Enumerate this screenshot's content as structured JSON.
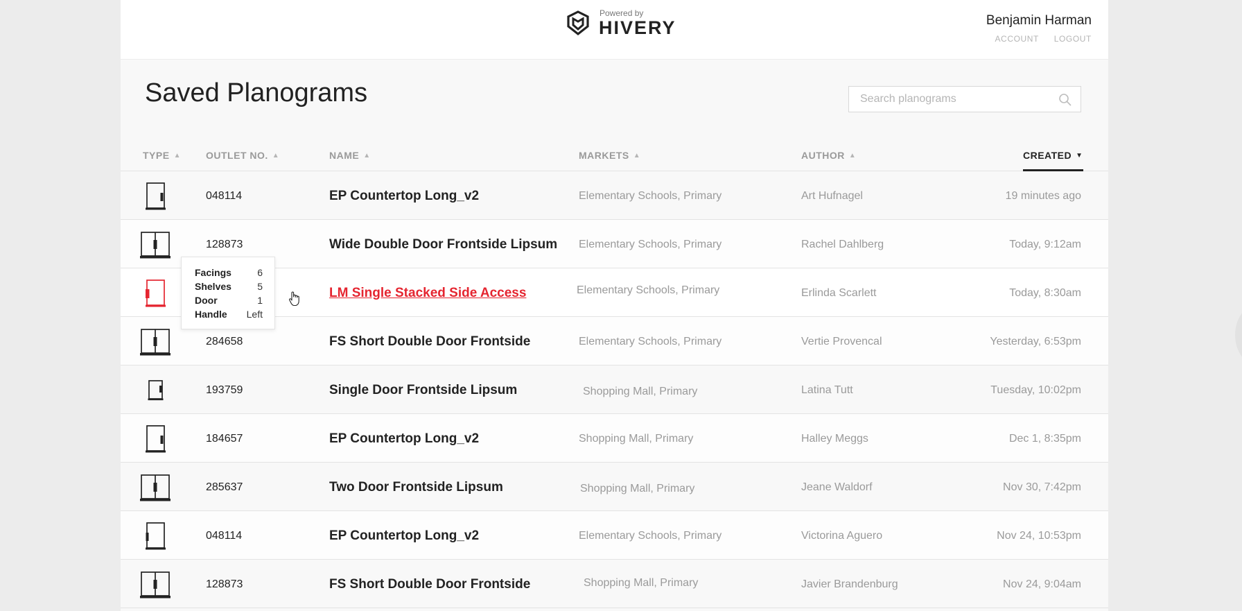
{
  "brand": {
    "powered_by": "Powered by",
    "name": "HIVERY"
  },
  "user": {
    "name": "Benjamin Harman",
    "account_label": "ACCOUNT",
    "logout_label": "LOGOUT"
  },
  "page": {
    "title": "Saved Planograms"
  },
  "search": {
    "placeholder": "Search planograms",
    "value": ""
  },
  "columns": {
    "type": "TYPE",
    "outlet": "OUTLET NO.",
    "name": "NAME",
    "markets": "MARKETS",
    "author": "AUTHOR",
    "created": "CREATED"
  },
  "rows": [
    {
      "type_icon": "countertop-right-icon",
      "outlet": "048114",
      "name": "EP Countertop Long_v2",
      "markets": "Elementary Schools, Primary",
      "author": "Art Hufnagel",
      "created": "19 minutes ago"
    },
    {
      "type_icon": "double-door-icon",
      "outlet": "128873",
      "name": "Wide Double Door Frontside Lipsum",
      "markets": "Elementary Schools, Primary",
      "author": "Rachel Dahlberg",
      "created": "Today, 9:12am"
    },
    {
      "type_icon": "single-door-left-icon",
      "outlet": "",
      "name": "LM Single Stacked Side Access",
      "markets": "Elementary Schools, Primary",
      "author": "Erlinda Scarlett",
      "created": "Today, 8:30am"
    },
    {
      "type_icon": "double-door-icon",
      "outlet": "284658",
      "name": "FS Short Double Door Frontside",
      "markets": "Elementary Schools, Primary",
      "author": "Vertie Provencal",
      "created": "Yesterday, 6:53pm"
    },
    {
      "type_icon": "small-door-right-icon",
      "outlet": "193759",
      "name": "Single Door Frontside Lipsum",
      "markets": "Shopping Mall, Primary",
      "author": "Latina Tutt",
      "created": "Tuesday, 10:02pm"
    },
    {
      "type_icon": "countertop-right-icon",
      "outlet": "184657",
      "name": "EP Countertop Long_v2",
      "markets": "Shopping Mall, Primary",
      "author": "Halley Meggs",
      "created": "Dec 1, 8:35pm"
    },
    {
      "type_icon": "double-door-icon",
      "outlet": "285637",
      "name": "Two Door Frontside Lipsum",
      "markets": "Shopping Mall, Primary",
      "author": "Jeane Waldorf",
      "created": "Nov 30, 7:42pm"
    },
    {
      "type_icon": "countertop-left-icon",
      "outlet": "048114",
      "name": "EP Countertop Long_v2",
      "markets": "Elementary Schools, Primary",
      "author": "Victorina Aguero",
      "created": "Nov 24, 10:53pm"
    },
    {
      "type_icon": "double-door-icon",
      "outlet": "128873",
      "name": "FS Short Double Door Frontside",
      "markets": "Shopping Mall, Primary",
      "author": "Javier Brandenburg",
      "created": "Nov 24, 9:04am"
    }
  ],
  "tooltip": {
    "facings_label": "Facings",
    "facings_value": "6",
    "shelves_label": "Shelves",
    "shelves_value": "5",
    "door_label": "Door",
    "door_value": "1",
    "handle_label": "Handle",
    "handle_value": "Left"
  },
  "colors": {
    "accent": "#e52530",
    "text": "#222222",
    "muted": "#9a9a9a"
  }
}
